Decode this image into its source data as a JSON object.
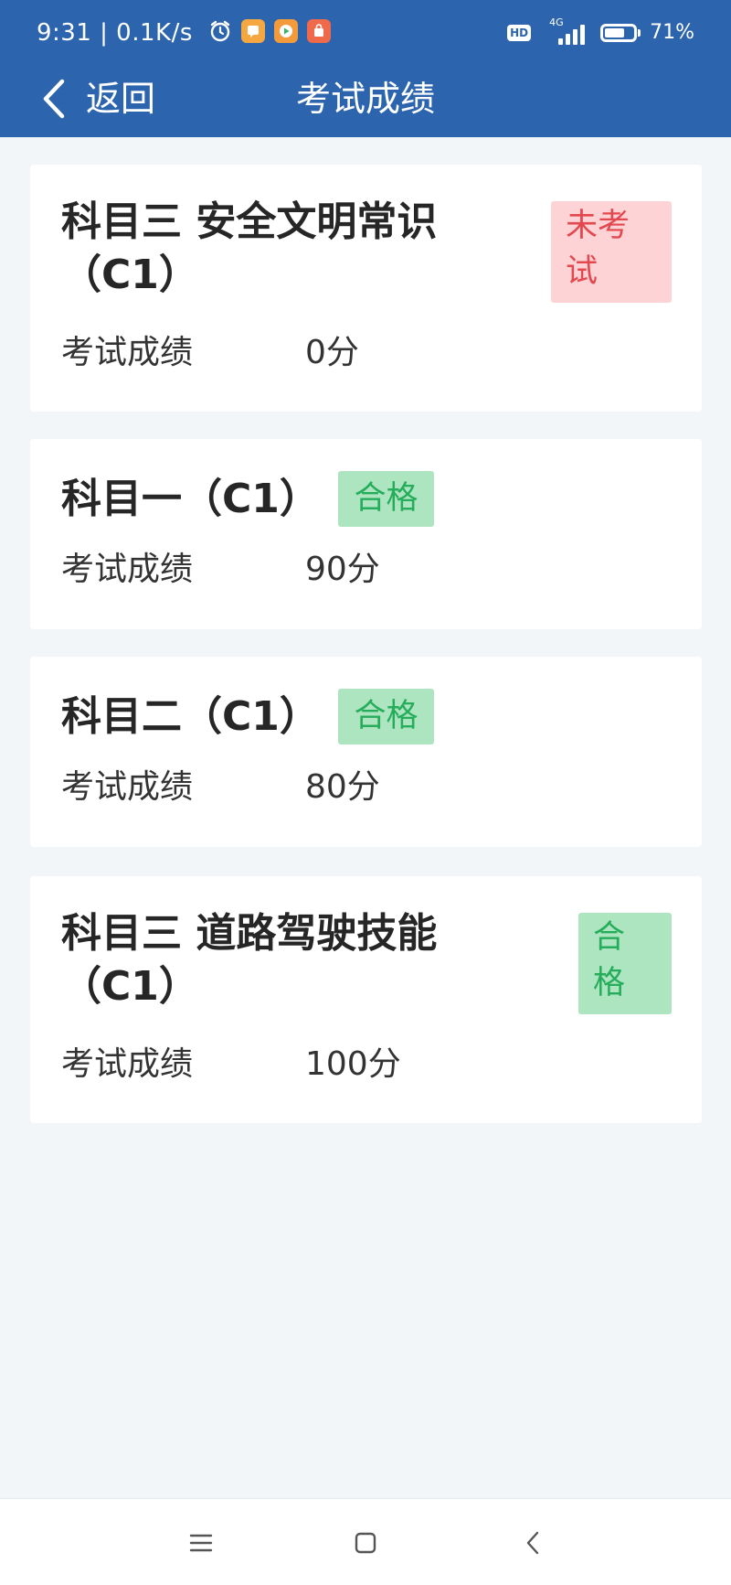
{
  "status_bar": {
    "time": "9:31 | 0.1K/s",
    "hd": "HD",
    "network": "4G",
    "battery": "71%",
    "battery_level": 0.71
  },
  "header": {
    "back_label": "返回",
    "title": "考试成绩"
  },
  "colors": {
    "header_bg": "#2d64ae",
    "page_bg": "#f3f6f9",
    "fail_badge_bg": "#fdd3d5",
    "fail_badge_text": "#e3484f",
    "pass_badge_bg": "#aee5c1",
    "pass_badge_text": "#26ad5b"
  },
  "cards": [
    {
      "title_line1": "科目三 安全文明常识",
      "title_line2": "（C1）",
      "status_line1": "未考",
      "status_line2": "试",
      "score_label": "考试成绩",
      "score_value": "0分"
    },
    {
      "title": "科目一（C1）",
      "status": "合格",
      "score_label": "考试成绩",
      "score_value": "90分"
    },
    {
      "title": "科目二（C1）",
      "status": "合格",
      "score_label": "考试成绩",
      "score_value": "80分"
    },
    {
      "title_line1": "科目三 道路驾驶技能",
      "title_line2": "（C1）",
      "status_line1": "合",
      "status_line2": "格",
      "score_label": "考试成绩",
      "score_value": "100分"
    }
  ],
  "system_nav": {
    "icons": [
      "menu-icon",
      "home-icon",
      "back-icon"
    ]
  }
}
